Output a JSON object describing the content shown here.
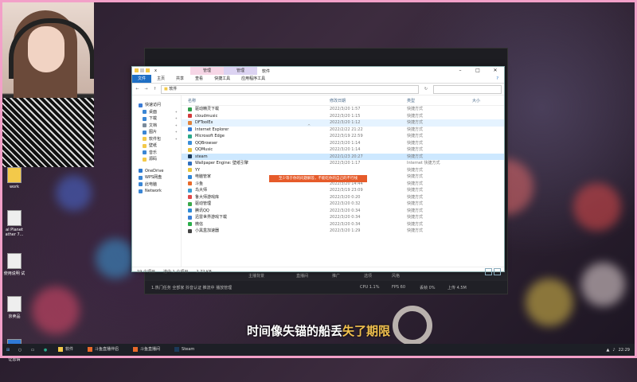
{
  "subtitle": {
    "before": "时间像失锚的船丢",
    "highlight": "失了期限"
  },
  "desktop_icons": [
    "work",
    "al Planet\nather 7...",
    "使用说明\n试",
    "京卖品",
    "让您请"
  ],
  "explorer": {
    "window_title": "软件",
    "context_tab_manage1": "管理",
    "context_tab_manage2": "管理",
    "title_short": "x",
    "ribbon": {
      "file": "文件",
      "home": "主页",
      "share": "共享",
      "view": "查看",
      "shortcut_tools": "快捷工具",
      "app_tools": "应用程序工具",
      "help": "?"
    },
    "address": {
      "path": "软件",
      "back": "←",
      "forward": "→",
      "up": "↑",
      "refresh": "↻",
      "search_placeholder": ""
    },
    "nav": [
      {
        "label": "快速访问",
        "icon": "star-icon",
        "color": "#3a7bd5",
        "sub": false
      },
      {
        "label": "桌面",
        "icon": "desktop-icon",
        "color": "#3a86d5",
        "sub": true
      },
      {
        "label": "下载",
        "icon": "download-icon",
        "color": "#3a86d5",
        "sub": true
      },
      {
        "label": "文档",
        "icon": "document-icon",
        "color": "#7a8a9a",
        "sub": true
      },
      {
        "label": "图片",
        "icon": "picture-icon",
        "color": "#3a86d5",
        "sub": true
      },
      {
        "label": "软件包",
        "icon": "folder-icon",
        "color": "#f3c94a",
        "sub": true
      },
      {
        "label": "壁纸",
        "icon": "folder-icon",
        "color": "#f3c94a",
        "sub": true
      },
      {
        "label": "音乐",
        "icon": "music-icon",
        "color": "#3a86d5",
        "sub": true
      },
      {
        "label": "源码",
        "icon": "folder-icon",
        "color": "#f3c94a",
        "sub": true
      },
      {
        "label": "OneDrive",
        "icon": "cloud-icon",
        "color": "#2a78d0",
        "sub": false
      },
      {
        "label": "WPS网盘",
        "icon": "cloud-icon",
        "color": "#3a86d5",
        "sub": false
      },
      {
        "label": "此电脑",
        "icon": "computer-icon",
        "color": "#3a86d5",
        "sub": false
      },
      {
        "label": "Network",
        "icon": "network-icon",
        "color": "#3a86d5",
        "sub": false
      }
    ],
    "columns": {
      "name": "名称",
      "date": "修改日期",
      "type": "类型",
      "size": "大小"
    },
    "files": [
      {
        "name": "驱动精灵下载",
        "date": "2022/3/20 1:57",
        "type": "快捷方式",
        "color": "#2e9e4a"
      },
      {
        "name": "cloudmusic",
        "date": "2022/3/20 1:15",
        "type": "快捷方式",
        "color": "#d33b3b"
      },
      {
        "name": "DFToolEx",
        "date": "2022/3/20 1:12",
        "type": "快捷方式",
        "color": "#e0823a"
      },
      {
        "name": "Internet Explorer",
        "date": "2022/2/22 21:22",
        "type": "快捷方式",
        "color": "#2f7ad6"
      },
      {
        "name": "Microsoft Edge",
        "date": "2022/3/19 22:59",
        "type": "快捷方式",
        "color": "#2aa88a"
      },
      {
        "name": "QQBrowser",
        "date": "2022/3/20 1:14",
        "type": "快捷方式",
        "color": "#3b8ed8"
      },
      {
        "name": "QQMusic",
        "date": "2022/3/20 1:14",
        "type": "快捷方式",
        "color": "#e7c23a"
      },
      {
        "name": "steam",
        "date": "2022/1/23 20:27",
        "type": "快捷方式",
        "color": "#1b3a5a"
      },
      {
        "name": "Wallpaper Engine: 壁纸引擎",
        "date": "2022/3/20 1:17",
        "type": "Internet 快捷方式",
        "color": "#2f6fbf"
      },
      {
        "name": "YY",
        "date": "",
        "type": "快捷方式",
        "color": "#e8c53a"
      },
      {
        "name": "电脑管家",
        "date": "",
        "type": "快捷方式",
        "color": "#2f86d6"
      },
      {
        "name": "斗鱼",
        "date": "2022/3/20 14:44",
        "type": "快捷方式",
        "color": "#e86a2a"
      },
      {
        "name": "鸟大师",
        "date": "2022/3/19 23:09",
        "type": "快捷方式",
        "color": "#3a9ed6"
      },
      {
        "name": "鲁大师游戏库",
        "date": "2022/3/20 0:20",
        "type": "快捷方式",
        "color": "#e04848"
      },
      {
        "name": "驱动管理",
        "date": "2022/3/20 0:32",
        "type": "快捷方式",
        "color": "#3aa84a"
      },
      {
        "name": "腾讯QQ",
        "date": "2022/3/20 0:34",
        "type": "快捷方式",
        "color": "#2d8ad6"
      },
      {
        "name": "迅雷世界游戏下载",
        "date": "2022/3/20 0:34",
        "type": "快捷方式",
        "color": "#3a7ed6"
      },
      {
        "name": "微信",
        "date": "2022/3/20 0:34",
        "type": "快捷方式",
        "color": "#2aae4a"
      },
      {
        "name": "小黑盒加速器",
        "date": "2022/3/20 1:29",
        "type": "快捷方式",
        "color": "#444444"
      }
    ],
    "status": {
      "count": "19 个项目",
      "selected": "选中 1 个项目",
      "size": "2.72 KB"
    }
  },
  "toast": "至少等于你的问题解答，不能吃你的自己的不行线",
  "bg_app": {
    "bar1": [
      "主播背景",
      "直播间",
      "推广",
      "选项",
      "风格"
    ],
    "bar2_left": "1.热门任务  全部家  抖音认证  推流中  播放管理",
    "bar2_right": [
      "CPU 1.1%",
      "FPS 60",
      "丢帧 0%",
      "上传 4.5M"
    ]
  },
  "taskbar": {
    "start": "⊞",
    "apps": [
      {
        "label": "软件",
        "color": "#f3c94a"
      },
      {
        "label": "斗鱼直播伴侣",
        "color": "#e86a2a"
      },
      {
        "label": "斗鱼直播间",
        "color": "#e86a2a"
      },
      {
        "label": "Steam",
        "color": "#1b3a5a"
      }
    ],
    "clock": "22:29"
  }
}
